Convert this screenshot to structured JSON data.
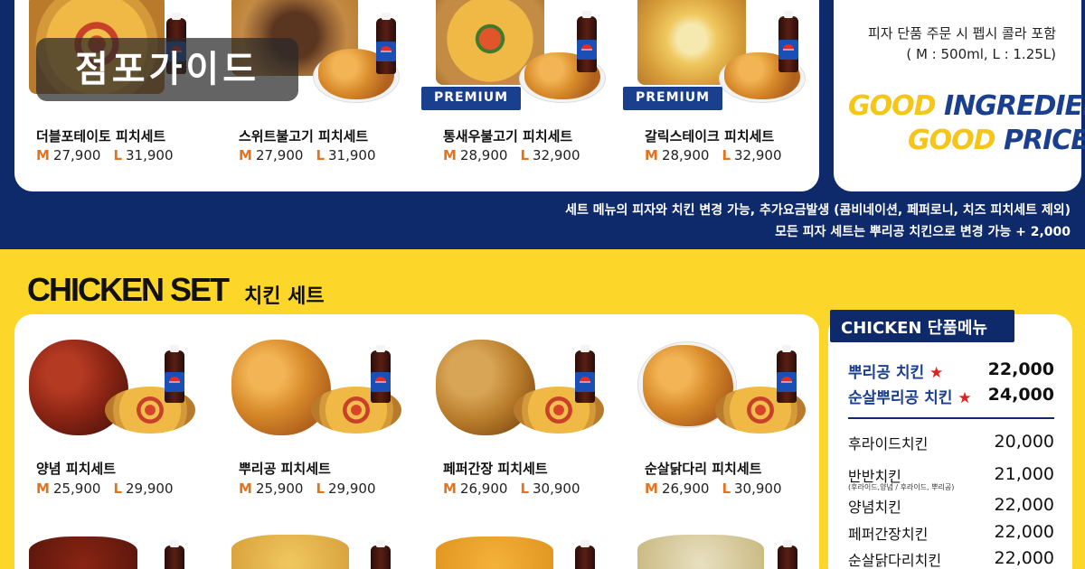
{
  "watermark": "점포가이드",
  "pizza_sets": [
    {
      "name": "더블포테이토 피치세트",
      "m": "27,900",
      "l": "31,900",
      "premium": false
    },
    {
      "name": "스위트불고기 피치세트",
      "m": "27,900",
      "l": "31,900",
      "premium": false
    },
    {
      "name": "통새우불고기 피치세트",
      "m": "28,900",
      "l": "32,900",
      "premium": true
    },
    {
      "name": "갈릭스테이크 피치세트",
      "m": "28,900",
      "l": "32,900",
      "premium": true
    }
  ],
  "size_labels": {
    "m": "M",
    "l": "L"
  },
  "premium_label": "PREMIUM",
  "cola_label": "PEPSI",
  "pizza_note": {
    "line1": "피자 단품 주문 시 펩시 콜라 포함",
    "line2": "( M : 500ml, L : 1.25L)"
  },
  "slogan": {
    "line1_a": "GOOD",
    "line1_b": "INGREDIENT!",
    "line2_a": "GOOD",
    "line2_b": "PRICE!"
  },
  "notices": [
    "세트 메뉴의 피자와 치킨 변경 가능, 추가요금발생 (콤비네이션, 페퍼로니, 치즈 피치세트 제외)",
    "모든 피자 세트는 뿌리공 치킨으로 변경 가능 + 2,000"
  ],
  "chicken_section": {
    "title": "CHICKEN SET",
    "subtitle": "치킨 세트"
  },
  "chicken_sets": [
    {
      "name": "양념  피치세트",
      "m": "25,900",
      "l": "29,900"
    },
    {
      "name": "뿌리공 피치세트",
      "m": "25,900",
      "l": "29,900"
    },
    {
      "name": "페퍼간장 피치세트",
      "m": "26,900",
      "l": "30,900"
    },
    {
      "name": "순살닭다리 피치세트",
      "m": "26,900",
      "l": "30,900"
    }
  ],
  "chicken_single": {
    "header": "CHICKEN 단품메뉴",
    "best": [
      {
        "name": "뿌리공 치킨",
        "star": "★",
        "price": "22,000"
      },
      {
        "name": "순살뿌리공 치킨",
        "star": "★",
        "price": "24,000"
      }
    ],
    "items": [
      {
        "name": "후라이드치킨",
        "price": "20,000",
        "sub": ""
      },
      {
        "name": "반반치킨",
        "price": "21,000",
        "sub": "(후라이드,양념 / 후라이드, 뿌리공)"
      },
      {
        "name": "양념치킨",
        "price": "22,000",
        "sub": ""
      },
      {
        "name": "페퍼간장치킨",
        "price": "22,000",
        "sub": ""
      },
      {
        "name": "순살닭다리치킨",
        "price": "22,000",
        "sub": ""
      }
    ]
  },
  "colors": {
    "navy": "#0e2a6b",
    "yellow": "#fcd72a",
    "accent_orange": "#e5731e",
    "star_red": "#e0211e"
  }
}
